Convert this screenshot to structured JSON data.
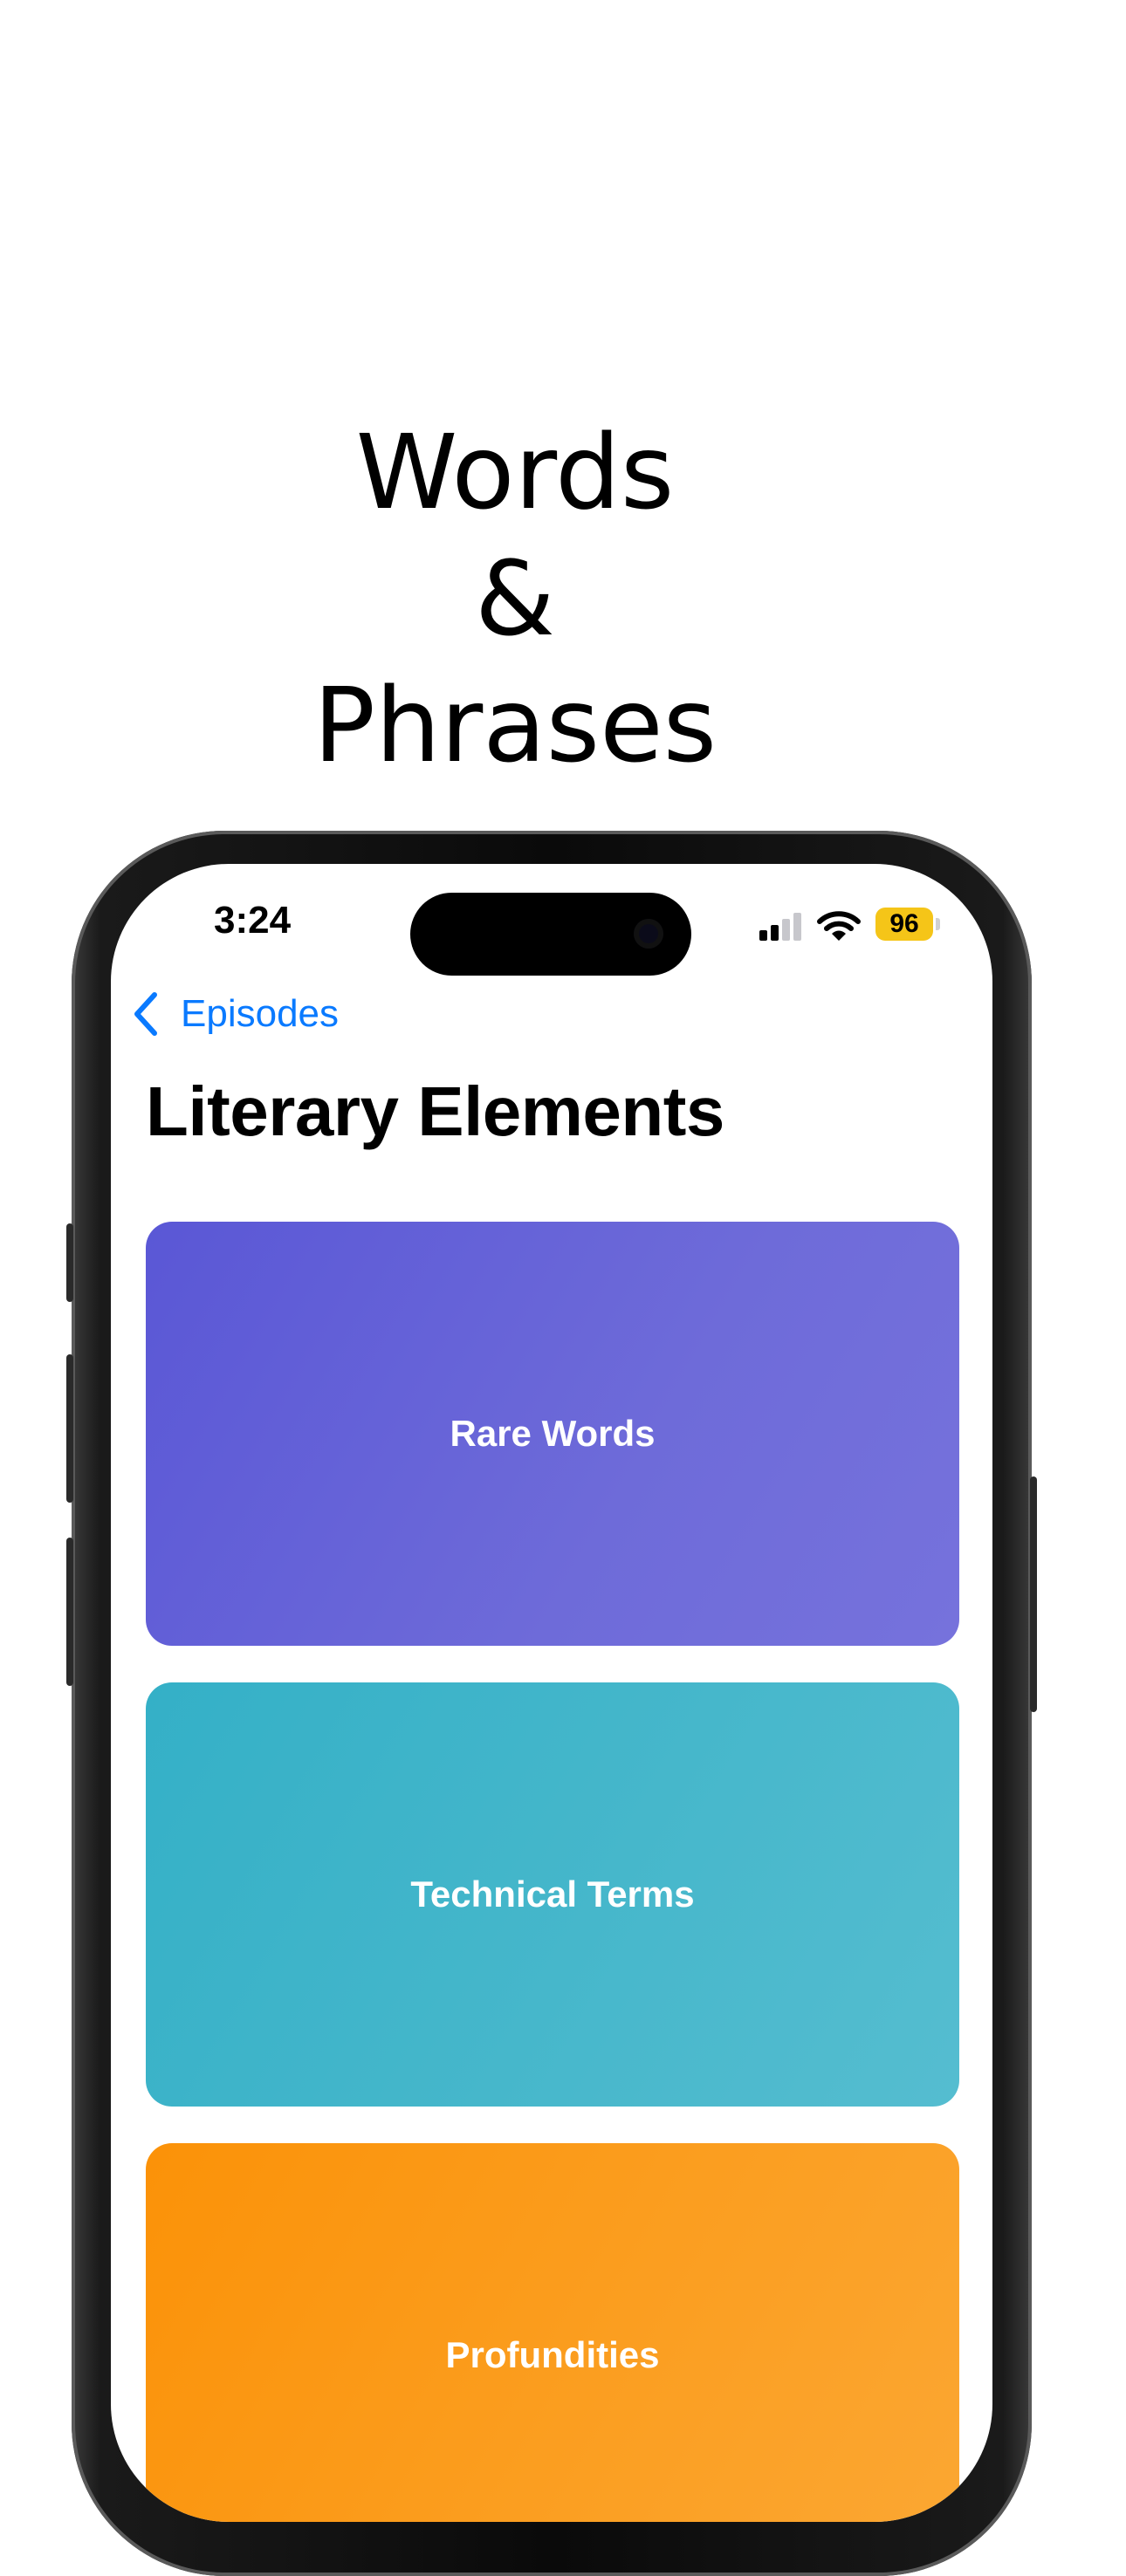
{
  "headline": {
    "line1": "Words",
    "line2": "&",
    "line3": "Phrases"
  },
  "status_bar": {
    "time": "3:24",
    "battery": "96",
    "signal_icon": "cellular-signal-icon",
    "wifi_icon": "wifi-icon",
    "battery_color": "#f5c518"
  },
  "nav": {
    "back_label": "Episodes",
    "back_icon": "chevron-left-icon",
    "accent_color": "#0a7aff"
  },
  "page": {
    "title": "Literary Elements"
  },
  "cards": [
    {
      "label": "Rare Words",
      "color": "#5a57d6"
    },
    {
      "label": "Technical Terms",
      "color": "#34b0c7"
    },
    {
      "label": "Profundities",
      "color": "#fb9208"
    }
  ]
}
